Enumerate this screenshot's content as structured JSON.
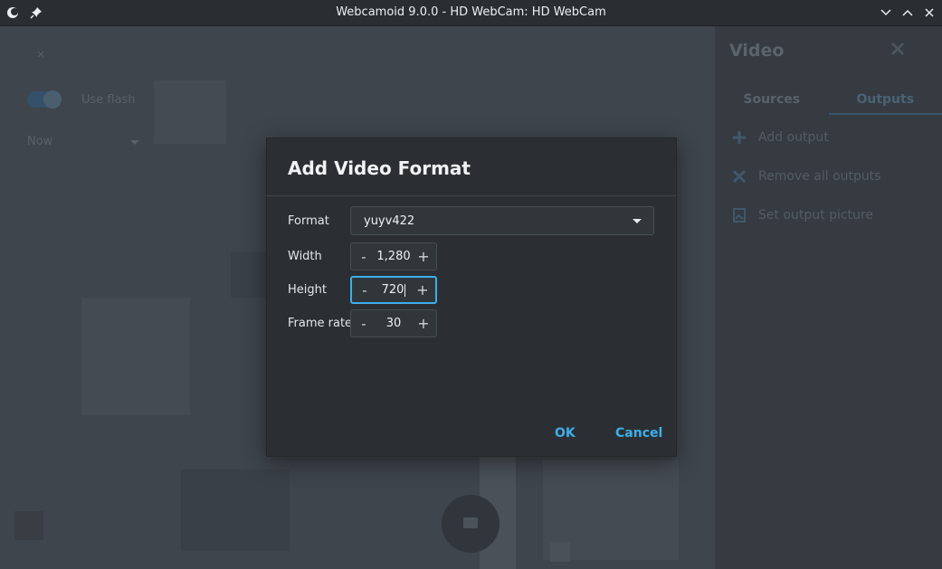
{
  "window": {
    "title": "Webcamoid 9.0.0 - HD WebCam: HD WebCam"
  },
  "background": {
    "use_flash_label": "Use flash",
    "flash_mode_value": "Now",
    "close_glyph": "×",
    "side_panel": {
      "title": "Video",
      "tabs": [
        {
          "label": "Sources",
          "active": false
        },
        {
          "label": "Outputs",
          "active": true
        }
      ],
      "items": [
        {
          "label": "Add output",
          "icon": "plus-icon"
        },
        {
          "label": "Remove all outputs",
          "icon": "close-icon"
        },
        {
          "label": "Set output picture",
          "icon": "picture-icon"
        }
      ]
    }
  },
  "dialog": {
    "title": "Add Video Format",
    "format": {
      "label": "Format",
      "value": "yuyv422"
    },
    "width": {
      "label": "Width",
      "value": "1,280"
    },
    "height": {
      "label": "Height",
      "value": "720"
    },
    "frame_rate": {
      "label": "Frame rate",
      "value": "30"
    },
    "decrement_glyph": "-",
    "increment_glyph": "+",
    "ok_label": "OK",
    "cancel_label": "Cancel"
  },
  "colors": {
    "accent": "#3daee9",
    "dialog_bg": "#2b2f33",
    "titlebar_bg": "#2a2e32"
  }
}
